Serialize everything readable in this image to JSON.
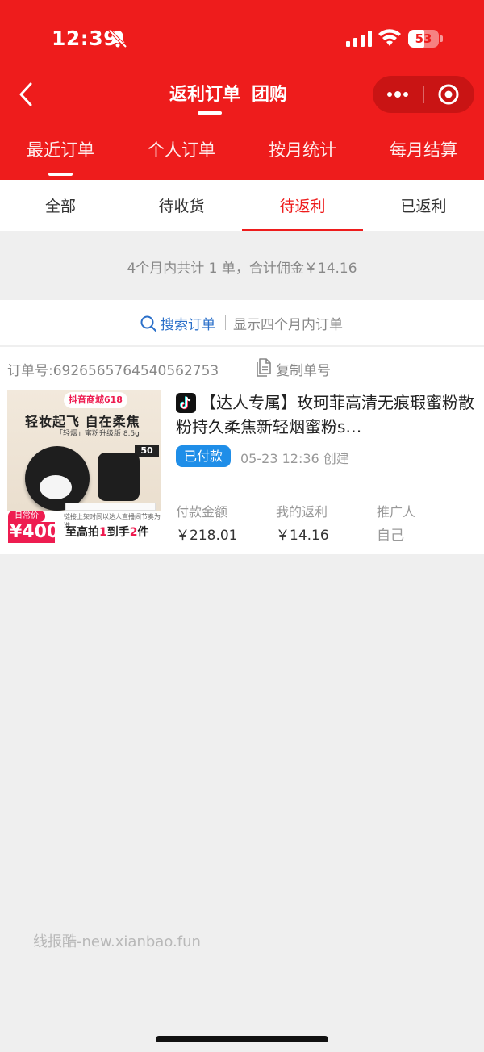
{
  "status_bar": {
    "time": "12:39",
    "battery": "53",
    "battery_level": 0.53
  },
  "nav": {
    "title_main": "返利订单",
    "title_secondary": "团购"
  },
  "top_tabs": [
    "最近订单",
    "个人订单",
    "按月统计",
    "每月结算"
  ],
  "sub_tabs": [
    "全部",
    "待收货",
    "待返利",
    "已返利"
  ],
  "active_sub_tab": "待返利",
  "summary": "4个月内共计 1 单，合计佣金￥14.16",
  "search": {
    "label": "搜索订单",
    "hint": "显示四个月内订单"
  },
  "order": {
    "number": "订单号:6926565764540562753",
    "copy_label": "复制单号",
    "title": "【达人专属】玫珂菲高清无痕瑕蜜粉散粉持久柔焦新轻烟蜜粉s…",
    "status": "已付款",
    "created": "05-23 12:36 创建",
    "stats": [
      {
        "label": "付款金额",
        "value": "￥218.01"
      },
      {
        "label": "我的返利",
        "value": "￥14.16"
      },
      {
        "label": "推广人",
        "value": "自己"
      }
    ],
    "thumbnail": {
      "badge": "抖音商城618",
      "headline": "轻妆起飞 自在柔焦",
      "sub": "「轻烟」蜜粉升级版 8.5g",
      "price_tag": "50",
      "daily_label": "日常价",
      "price": "¥400",
      "note": "链接上架时间以达人直播间节奏为准",
      "deal_parts": [
        "至高拍",
        "1",
        "到手",
        "2",
        "件"
      ]
    }
  },
  "watermark": "线报酷-new.xianbao.fun",
  "colors": {
    "brand_red": "#ee1c1c",
    "link_blue": "#2a6fc9",
    "badge_blue": "#1f8ee8"
  }
}
